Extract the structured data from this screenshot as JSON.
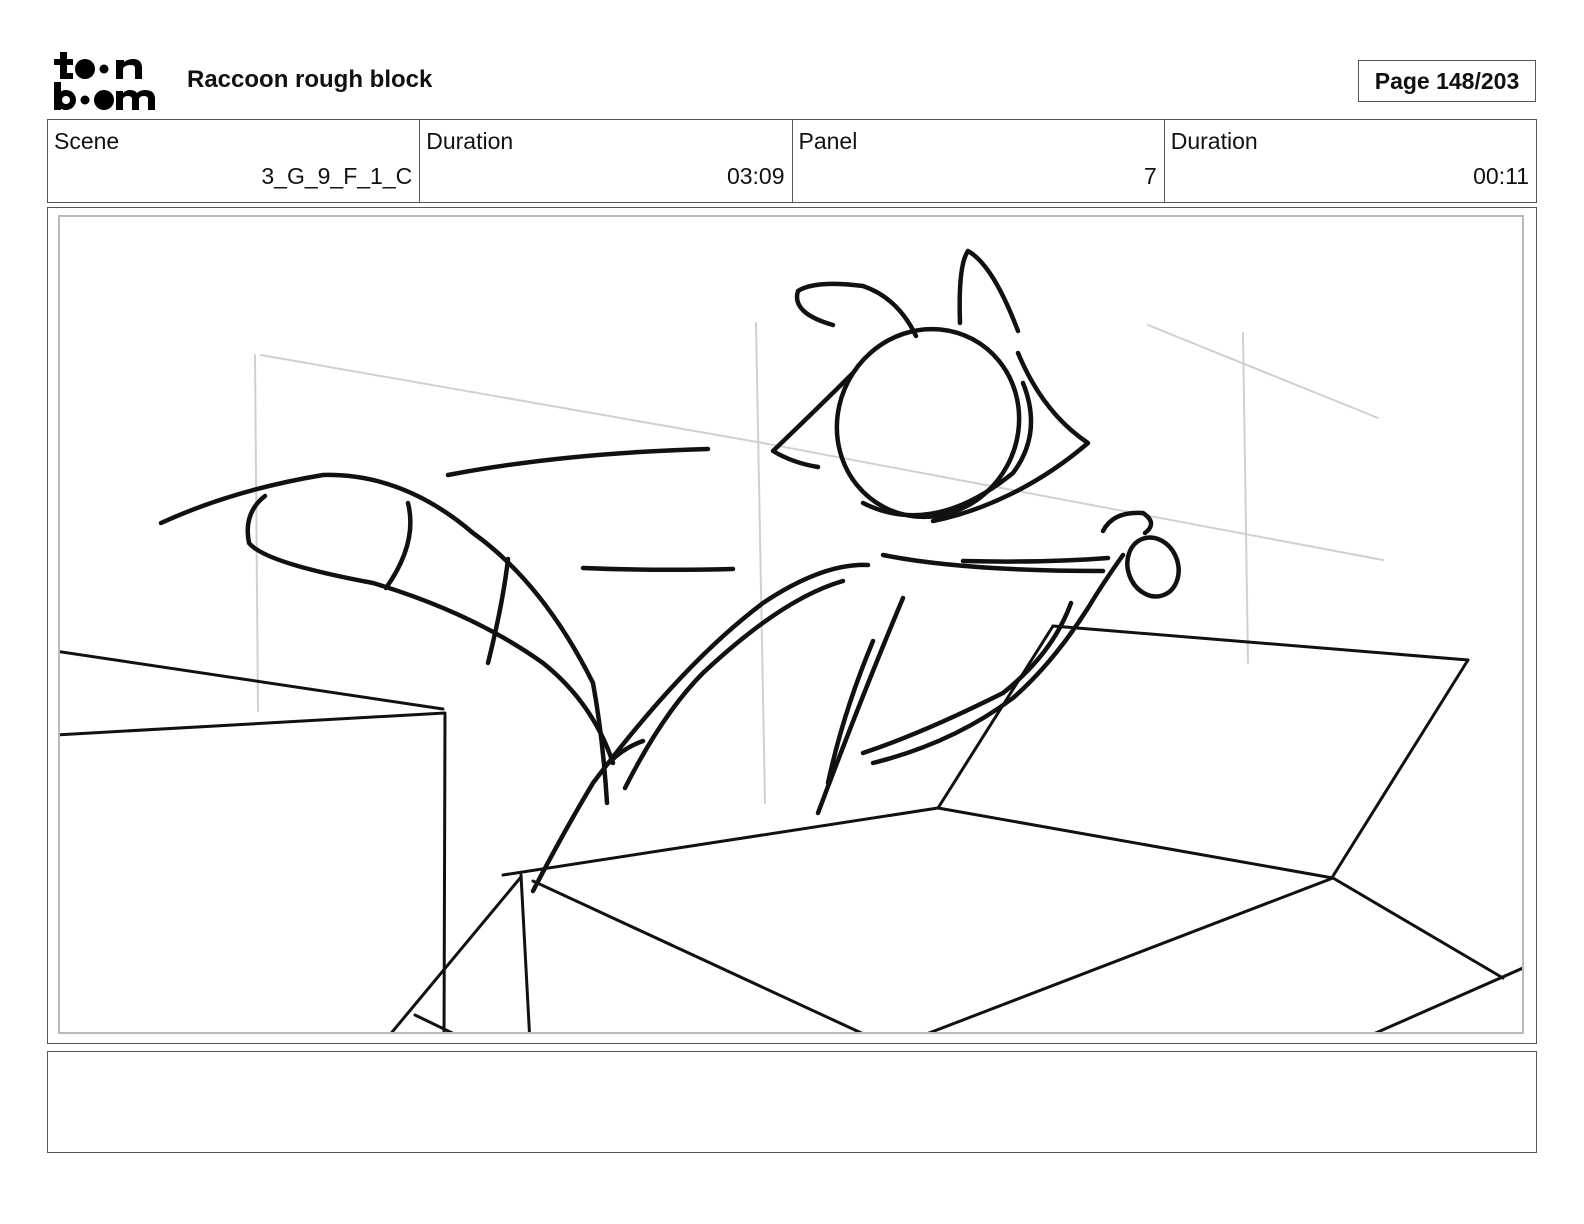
{
  "header": {
    "logo_name": "toonboom-logo",
    "title": "Raccoon rough block",
    "page_label": "Page 148/203"
  },
  "info": {
    "scene_label": "Scene",
    "scene_value": "3_G_9_F_1_C",
    "scene_duration_label": "Duration",
    "scene_duration_value": "03:09",
    "panel_label": "Panel",
    "panel_value": "7",
    "panel_duration_label": "Duration",
    "panel_duration_value": "00:11"
  },
  "notes": {
    "text": ""
  }
}
